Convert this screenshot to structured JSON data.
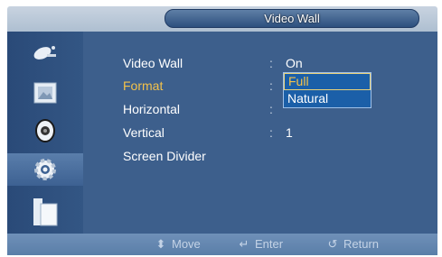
{
  "header": {
    "title": "Video Wall"
  },
  "sidebar": {
    "items": [
      {
        "icon": "satellite-dish-icon",
        "active": false
      },
      {
        "icon": "picture-frame-icon",
        "active": false
      },
      {
        "icon": "speaker-icon",
        "active": false
      },
      {
        "icon": "gear-icon",
        "active": true
      },
      {
        "icon": "window-stack-icon",
        "active": false
      }
    ]
  },
  "menu": {
    "items": [
      {
        "label": "Video Wall",
        "value": "On"
      },
      {
        "label": "Format",
        "value": "",
        "highlighted": true
      },
      {
        "label": "Horizontal",
        "value": ""
      },
      {
        "label": "Vertical",
        "value": "1"
      },
      {
        "label": "Screen Divider",
        "value": ""
      }
    ],
    "separator": ":"
  },
  "popup": {
    "options": [
      "Full",
      "Natural"
    ],
    "selected": "Full"
  },
  "footer": {
    "move": {
      "icon": "up-down-arrows-icon",
      "label": "Move"
    },
    "enter": {
      "icon": "enter-icon",
      "label": "Enter"
    },
    "return": {
      "icon": "return-icon",
      "label": "Return"
    }
  },
  "colors": {
    "highlight": "#f4c24a",
    "panel": "#3d5f8c",
    "popup": "#1b5fa8"
  }
}
